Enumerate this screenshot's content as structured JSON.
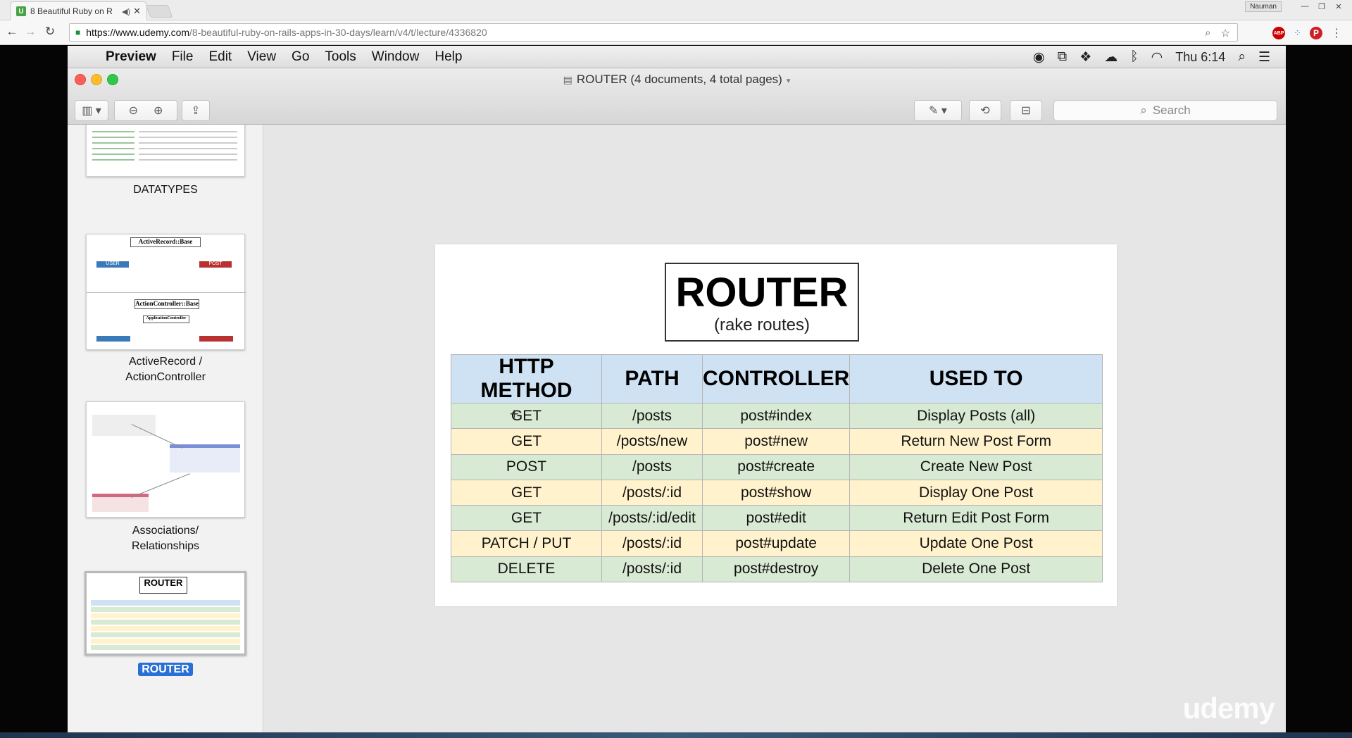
{
  "browser": {
    "tab_title": "8 Beautiful Ruby on R",
    "tab_favicon": "U",
    "user_badge": "Nauman",
    "url_host": "https://www.udemy.com",
    "url_path": "/8-beautiful-ruby-on-rails-apps-in-30-days/learn/v4/t/lecture/4336820"
  },
  "mac_menu": {
    "app": "Preview",
    "items": [
      "File",
      "Edit",
      "View",
      "Go",
      "Tools",
      "Window",
      "Help"
    ],
    "clock": "Thu 6:14"
  },
  "preview": {
    "window_title": "ROUTER (4 documents, 4 total pages)",
    "search_placeholder": "Search"
  },
  "sidebar": {
    "thumbs": [
      {
        "label": "DATATYPES"
      },
      {
        "label_line1": "ActiveRecord /",
        "label_line2": "ActionController",
        "box1": "ActiveRecord::Base",
        "box2": "ActionController::Base",
        "box3": "ApplicationController",
        "tag_user": "USER",
        "tag_post": "POST"
      },
      {
        "label_line1": "Associations/",
        "label_line2": "Relationships"
      },
      {
        "label": "ROUTER",
        "mini_title": "ROUTER"
      }
    ]
  },
  "slide": {
    "title": "ROUTER",
    "subtitle": "(rake routes)",
    "headers": [
      "HTTP METHOD",
      "PATH",
      "CONTROLLER",
      "USED TO"
    ],
    "rows": [
      [
        "GET",
        "/posts",
        "post#index",
        "Display Posts (all)"
      ],
      [
        "GET",
        "/posts/new",
        "post#new",
        "Return New Post Form"
      ],
      [
        "POST",
        "/posts",
        "post#create",
        "Create New Post"
      ],
      [
        "GET",
        "/posts/:id",
        "post#show",
        "Display One Post"
      ],
      [
        "GET",
        "/posts/:id/edit",
        "post#edit",
        "Return Edit Post Form"
      ],
      [
        "PATCH / PUT",
        "/posts/:id",
        "post#update",
        "Update One Post"
      ],
      [
        "DELETE",
        "/posts/:id",
        "post#destroy",
        "Delete One Post"
      ]
    ]
  },
  "watermark": "udemy"
}
